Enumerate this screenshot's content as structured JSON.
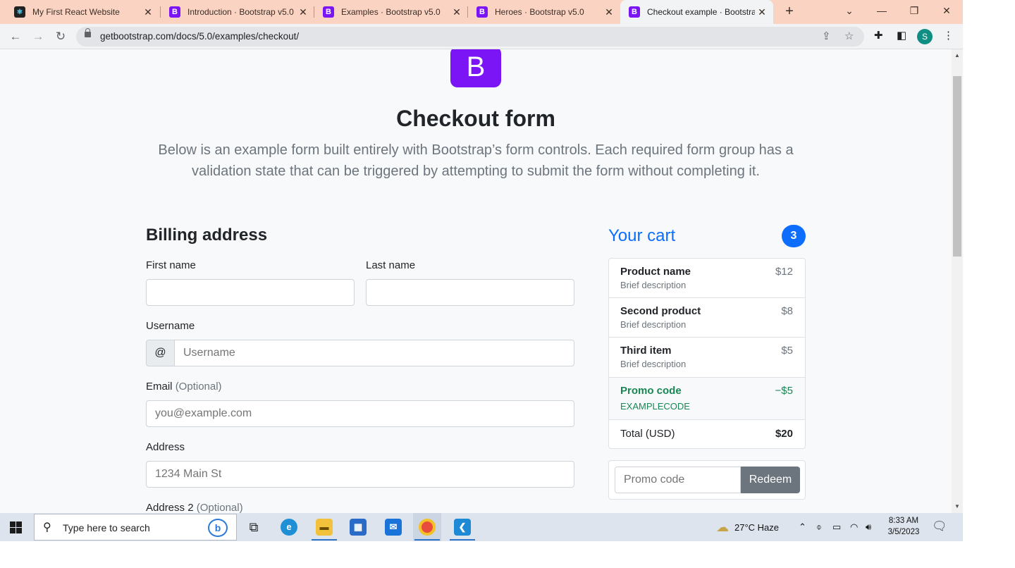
{
  "browser": {
    "tabs": [
      {
        "title": "My First React Website",
        "favicon": "react-icon",
        "active": false
      },
      {
        "title": "Introduction · Bootstrap v5.0",
        "favicon": "bootstrap-icon",
        "active": false
      },
      {
        "title": "Examples · Bootstrap v5.0",
        "favicon": "bootstrap-icon",
        "active": false
      },
      {
        "title": "Heroes · Bootstrap v5.0",
        "favicon": "bootstrap-icon",
        "active": false
      },
      {
        "title": "Checkout example · Bootstrap",
        "favicon": "bootstrap-icon",
        "active": true
      }
    ],
    "url": "getbootstrap.com/docs/5.0/examples/checkout/",
    "profile_initial": "S"
  },
  "page": {
    "logo_letter": "B",
    "title": "Checkout form",
    "lead": "Below is an example form built entirely with Bootstrap’s form controls. Each required form group has a validation state that can be triggered by attempting to submit the form without completing it.",
    "billing": {
      "heading": "Billing address",
      "first_name_label": "First name",
      "first_name_value": "",
      "last_name_label": "Last name",
      "last_name_value": "",
      "username_label": "Username",
      "username_prefix": "@",
      "username_placeholder": "Username",
      "email_label": "Email",
      "email_optional": "(Optional)",
      "email_placeholder": "you@example.com",
      "address_label": "Address",
      "address_placeholder": "1234 Main St",
      "address2_label": "Address 2",
      "address2_optional": "(Optional)"
    },
    "cart": {
      "heading": "Your cart",
      "count": "3",
      "items": [
        {
          "name": "Product name",
          "desc": "Brief description",
          "price": "$12"
        },
        {
          "name": "Second product",
          "desc": "Brief description",
          "price": "$8"
        },
        {
          "name": "Third item",
          "desc": "Brief description",
          "price": "$5"
        }
      ],
      "promo": {
        "name": "Promo code",
        "code": "EXAMPLECODE",
        "amount": "−$5"
      },
      "total_label": "Total (USD)",
      "total_value": "$20",
      "promo_placeholder": "Promo code",
      "redeem_label": "Redeem"
    }
  },
  "taskbar": {
    "search_placeholder": "Type here to search",
    "weather": "27°C  Haze",
    "time": "8:33 AM",
    "date": "3/5/2023"
  },
  "colors": {
    "bootstrap_purple": "#7b15f5",
    "primary": "#0d6efd",
    "success": "#198754",
    "secondary": "#6c757d",
    "tabstrip": "#fbd3c3"
  }
}
